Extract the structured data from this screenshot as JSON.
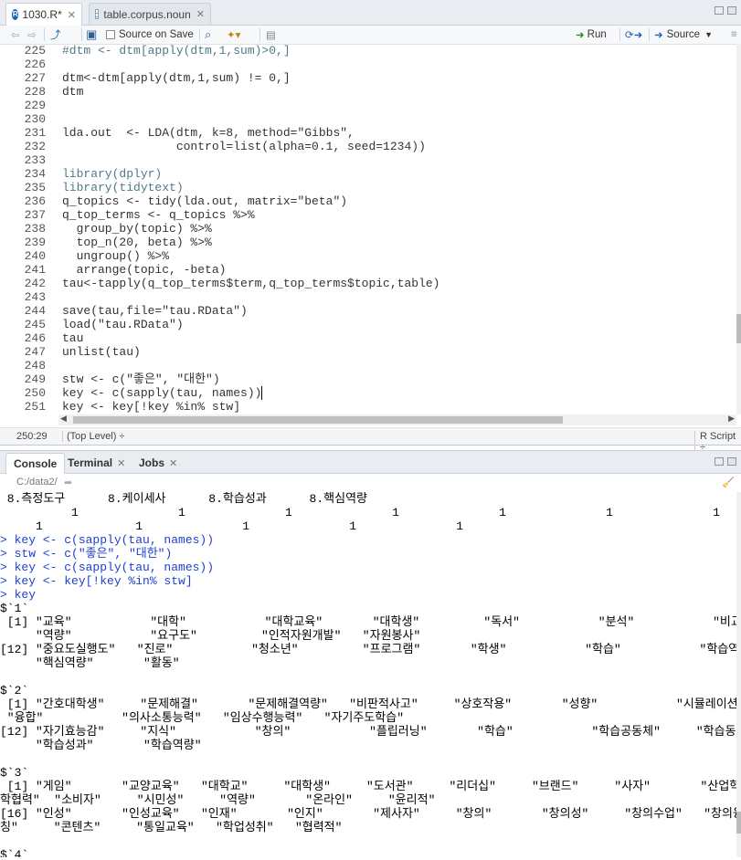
{
  "editor": {
    "tabs": [
      {
        "label": "1030.R*",
        "icon": "r-file-icon"
      },
      {
        "label": "table.corpus.noun",
        "icon": "table-icon"
      }
    ],
    "toolbar": {
      "source_on_save": "Source on Save",
      "run": "Run",
      "source": "Source"
    },
    "lines": [
      {
        "n": "225",
        "t": "#dtm <- dtm[apply(dtm,1,sum)>0,]",
        "k": "comment"
      },
      {
        "n": "226",
        "t": ""
      },
      {
        "n": "227",
        "t": "dtm<-dtm[apply(dtm,1,sum) != 0,]"
      },
      {
        "n": "228",
        "t": "dtm"
      },
      {
        "n": "229",
        "t": ""
      },
      {
        "n": "230",
        "t": ""
      },
      {
        "n": "231",
        "t": "lda.out  <- LDA(dtm, k=8, method=\"Gibbs\","
      },
      {
        "n": "232",
        "t": "                control=list(alpha=0.1, seed=1234))"
      },
      {
        "n": "233",
        "t": ""
      },
      {
        "n": "234",
        "t": "library(dplyr)",
        "k": "lib"
      },
      {
        "n": "235",
        "t": "library(tidytext)",
        "k": "lib"
      },
      {
        "n": "236",
        "t": "q_topics <- tidy(lda.out, matrix=\"beta\")"
      },
      {
        "n": "237",
        "t": "q_top_terms <- q_topics %>%"
      },
      {
        "n": "238",
        "t": "  group_by(topic) %>%"
      },
      {
        "n": "239",
        "t": "  top_n(20, beta) %>%"
      },
      {
        "n": "240",
        "t": "  ungroup() %>%"
      },
      {
        "n": "241",
        "t": "  arrange(topic, -beta)"
      },
      {
        "n": "242",
        "t": "tau<-tapply(q_top_terms$term,q_top_terms$topic,table)"
      },
      {
        "n": "243",
        "t": ""
      },
      {
        "n": "244",
        "t": "save(tau,file=\"tau.RData\")"
      },
      {
        "n": "245",
        "t": "load(\"tau.RData\")"
      },
      {
        "n": "246",
        "t": "tau"
      },
      {
        "n": "247",
        "t": "unlist(tau)"
      },
      {
        "n": "248",
        "t": ""
      },
      {
        "n": "249",
        "t": "stw <- c(\"좋은\", \"대한\")"
      },
      {
        "n": "250",
        "t": "key <- c(sapply(tau, names))"
      },
      {
        "n": "251",
        "t": "key <- key[!key %in% stw]"
      },
      {
        "n": "252",
        "t": ""
      }
    ],
    "status": {
      "position": "250:29",
      "scope": "(Top Level) ÷",
      "filetype": "R Script ÷"
    }
  },
  "console": {
    "tabs": [
      {
        "label": "Console"
      },
      {
        "label": "Terminal"
      },
      {
        "label": "Jobs"
      }
    ],
    "path": "C:/data2/",
    "lines": [
      {
        "t": " 8.측정도구      8.케이세사      8.학습성과      8.핵심역량"
      },
      {
        "t": "          1              1              1              1              1              1              1"
      },
      {
        "t": "     1             1              1              1              1"
      },
      {
        "t": "> key <- c(sapply(tau, names))",
        "k": "cmd"
      },
      {
        "t": "> stw <- c(\"좋은\", \"대한\")",
        "k": "cmd"
      },
      {
        "t": "> key <- c(sapply(tau, names))",
        "k": "cmd"
      },
      {
        "t": "> key <- key[!key %in% stw]",
        "k": "cmd"
      },
      {
        "t": "> key",
        "k": "cmd"
      },
      {
        "t": "$`1`"
      },
      {
        "t": " [1] \"교육\"           \"대학\"           \"대학교육\"       \"대학생\"         \"독서\"           \"분석\"           \"비교과\""
      },
      {
        "t": "     \"역량\"           \"요구도\"         \"인적자원개발\"   \"자원봉사\""
      },
      {
        "t": "[12] \"중요도실행도\"   \"진로\"           \"청소년\"         \"프로그램\"       \"학생\"           \"학습\"           \"학습역량\""
      },
      {
        "t": "     \"핵심역량\"       \"활동\""
      },
      {
        "t": ""
      },
      {
        "t": "$`2`"
      },
      {
        "t": " [1] \"간호대학생\"     \"문제해결\"       \"문제해결역량\"   \"비판적사고\"     \"상호작용\"       \"성향\"           \"시뮬레이션\""
      },
      {
        "t": " \"융합\"           \"의사소통능력\"   \"임상수행능력\"   \"자기주도학습\""
      },
      {
        "t": "[12] \"자기효능감\"     \"지식\"           \"창의\"           \"플립러닝\"       \"학습\"           \"학습공동체\"     \"학습동기\""
      },
      {
        "t": "     \"학습성과\"       \"학습역량\""
      },
      {
        "t": ""
      },
      {
        "t": "$`3`"
      },
      {
        "t": " [1] \"게임\"       \"교양교육\"   \"대학교\"     \"대학생\"     \"도서관\"     \"리더십\"     \"브랜드\"     \"사자\"       \"산업혁명\"   \"산"
      },
      {
        "t": "학협력\"  \"소비자\"     \"시민성\"     \"역량\"       \"온라인\"     \"윤리적\""
      },
      {
        "t": "[16] \"인성\"       \"인성교육\"   \"인재\"       \"인지\"       \"제사자\"     \"창의\"       \"창의성\"     \"창의수업\"   \"창의융합\"   \"코"
      },
      {
        "t": "칭\"     \"콘텐츠\"     \"통일교육\"   \"학업성취\"   \"협력적\""
      },
      {
        "t": ""
      },
      {
        "t": "$`4`"
      }
    ]
  }
}
